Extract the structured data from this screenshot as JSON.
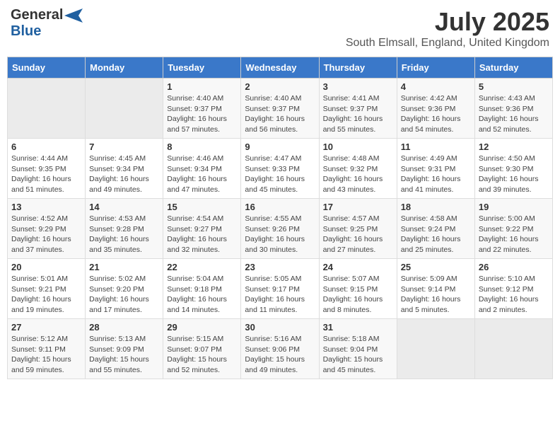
{
  "header": {
    "logo_general": "General",
    "logo_blue": "Blue",
    "month_title": "July 2025",
    "location": "South Elmsall, England, United Kingdom"
  },
  "days_of_week": [
    "Sunday",
    "Monday",
    "Tuesday",
    "Wednesday",
    "Thursday",
    "Friday",
    "Saturday"
  ],
  "weeks": [
    [
      {
        "day": "",
        "info": ""
      },
      {
        "day": "",
        "info": ""
      },
      {
        "day": "1",
        "info": "Sunrise: 4:40 AM\nSunset: 9:37 PM\nDaylight: 16 hours and 57 minutes."
      },
      {
        "day": "2",
        "info": "Sunrise: 4:40 AM\nSunset: 9:37 PM\nDaylight: 16 hours and 56 minutes."
      },
      {
        "day": "3",
        "info": "Sunrise: 4:41 AM\nSunset: 9:37 PM\nDaylight: 16 hours and 55 minutes."
      },
      {
        "day": "4",
        "info": "Sunrise: 4:42 AM\nSunset: 9:36 PM\nDaylight: 16 hours and 54 minutes."
      },
      {
        "day": "5",
        "info": "Sunrise: 4:43 AM\nSunset: 9:36 PM\nDaylight: 16 hours and 52 minutes."
      }
    ],
    [
      {
        "day": "6",
        "info": "Sunrise: 4:44 AM\nSunset: 9:35 PM\nDaylight: 16 hours and 51 minutes."
      },
      {
        "day": "7",
        "info": "Sunrise: 4:45 AM\nSunset: 9:34 PM\nDaylight: 16 hours and 49 minutes."
      },
      {
        "day": "8",
        "info": "Sunrise: 4:46 AM\nSunset: 9:34 PM\nDaylight: 16 hours and 47 minutes."
      },
      {
        "day": "9",
        "info": "Sunrise: 4:47 AM\nSunset: 9:33 PM\nDaylight: 16 hours and 45 minutes."
      },
      {
        "day": "10",
        "info": "Sunrise: 4:48 AM\nSunset: 9:32 PM\nDaylight: 16 hours and 43 minutes."
      },
      {
        "day": "11",
        "info": "Sunrise: 4:49 AM\nSunset: 9:31 PM\nDaylight: 16 hours and 41 minutes."
      },
      {
        "day": "12",
        "info": "Sunrise: 4:50 AM\nSunset: 9:30 PM\nDaylight: 16 hours and 39 minutes."
      }
    ],
    [
      {
        "day": "13",
        "info": "Sunrise: 4:52 AM\nSunset: 9:29 PM\nDaylight: 16 hours and 37 minutes."
      },
      {
        "day": "14",
        "info": "Sunrise: 4:53 AM\nSunset: 9:28 PM\nDaylight: 16 hours and 35 minutes."
      },
      {
        "day": "15",
        "info": "Sunrise: 4:54 AM\nSunset: 9:27 PM\nDaylight: 16 hours and 32 minutes."
      },
      {
        "day": "16",
        "info": "Sunrise: 4:55 AM\nSunset: 9:26 PM\nDaylight: 16 hours and 30 minutes."
      },
      {
        "day": "17",
        "info": "Sunrise: 4:57 AM\nSunset: 9:25 PM\nDaylight: 16 hours and 27 minutes."
      },
      {
        "day": "18",
        "info": "Sunrise: 4:58 AM\nSunset: 9:24 PM\nDaylight: 16 hours and 25 minutes."
      },
      {
        "day": "19",
        "info": "Sunrise: 5:00 AM\nSunset: 9:22 PM\nDaylight: 16 hours and 22 minutes."
      }
    ],
    [
      {
        "day": "20",
        "info": "Sunrise: 5:01 AM\nSunset: 9:21 PM\nDaylight: 16 hours and 19 minutes."
      },
      {
        "day": "21",
        "info": "Sunrise: 5:02 AM\nSunset: 9:20 PM\nDaylight: 16 hours and 17 minutes."
      },
      {
        "day": "22",
        "info": "Sunrise: 5:04 AM\nSunset: 9:18 PM\nDaylight: 16 hours and 14 minutes."
      },
      {
        "day": "23",
        "info": "Sunrise: 5:05 AM\nSunset: 9:17 PM\nDaylight: 16 hours and 11 minutes."
      },
      {
        "day": "24",
        "info": "Sunrise: 5:07 AM\nSunset: 9:15 PM\nDaylight: 16 hours and 8 minutes."
      },
      {
        "day": "25",
        "info": "Sunrise: 5:09 AM\nSunset: 9:14 PM\nDaylight: 16 hours and 5 minutes."
      },
      {
        "day": "26",
        "info": "Sunrise: 5:10 AM\nSunset: 9:12 PM\nDaylight: 16 hours and 2 minutes."
      }
    ],
    [
      {
        "day": "27",
        "info": "Sunrise: 5:12 AM\nSunset: 9:11 PM\nDaylight: 15 hours and 59 minutes."
      },
      {
        "day": "28",
        "info": "Sunrise: 5:13 AM\nSunset: 9:09 PM\nDaylight: 15 hours and 55 minutes."
      },
      {
        "day": "29",
        "info": "Sunrise: 5:15 AM\nSunset: 9:07 PM\nDaylight: 15 hours and 52 minutes."
      },
      {
        "day": "30",
        "info": "Sunrise: 5:16 AM\nSunset: 9:06 PM\nDaylight: 15 hours and 49 minutes."
      },
      {
        "day": "31",
        "info": "Sunrise: 5:18 AM\nSunset: 9:04 PM\nDaylight: 15 hours and 45 minutes."
      },
      {
        "day": "",
        "info": ""
      },
      {
        "day": "",
        "info": ""
      }
    ]
  ]
}
